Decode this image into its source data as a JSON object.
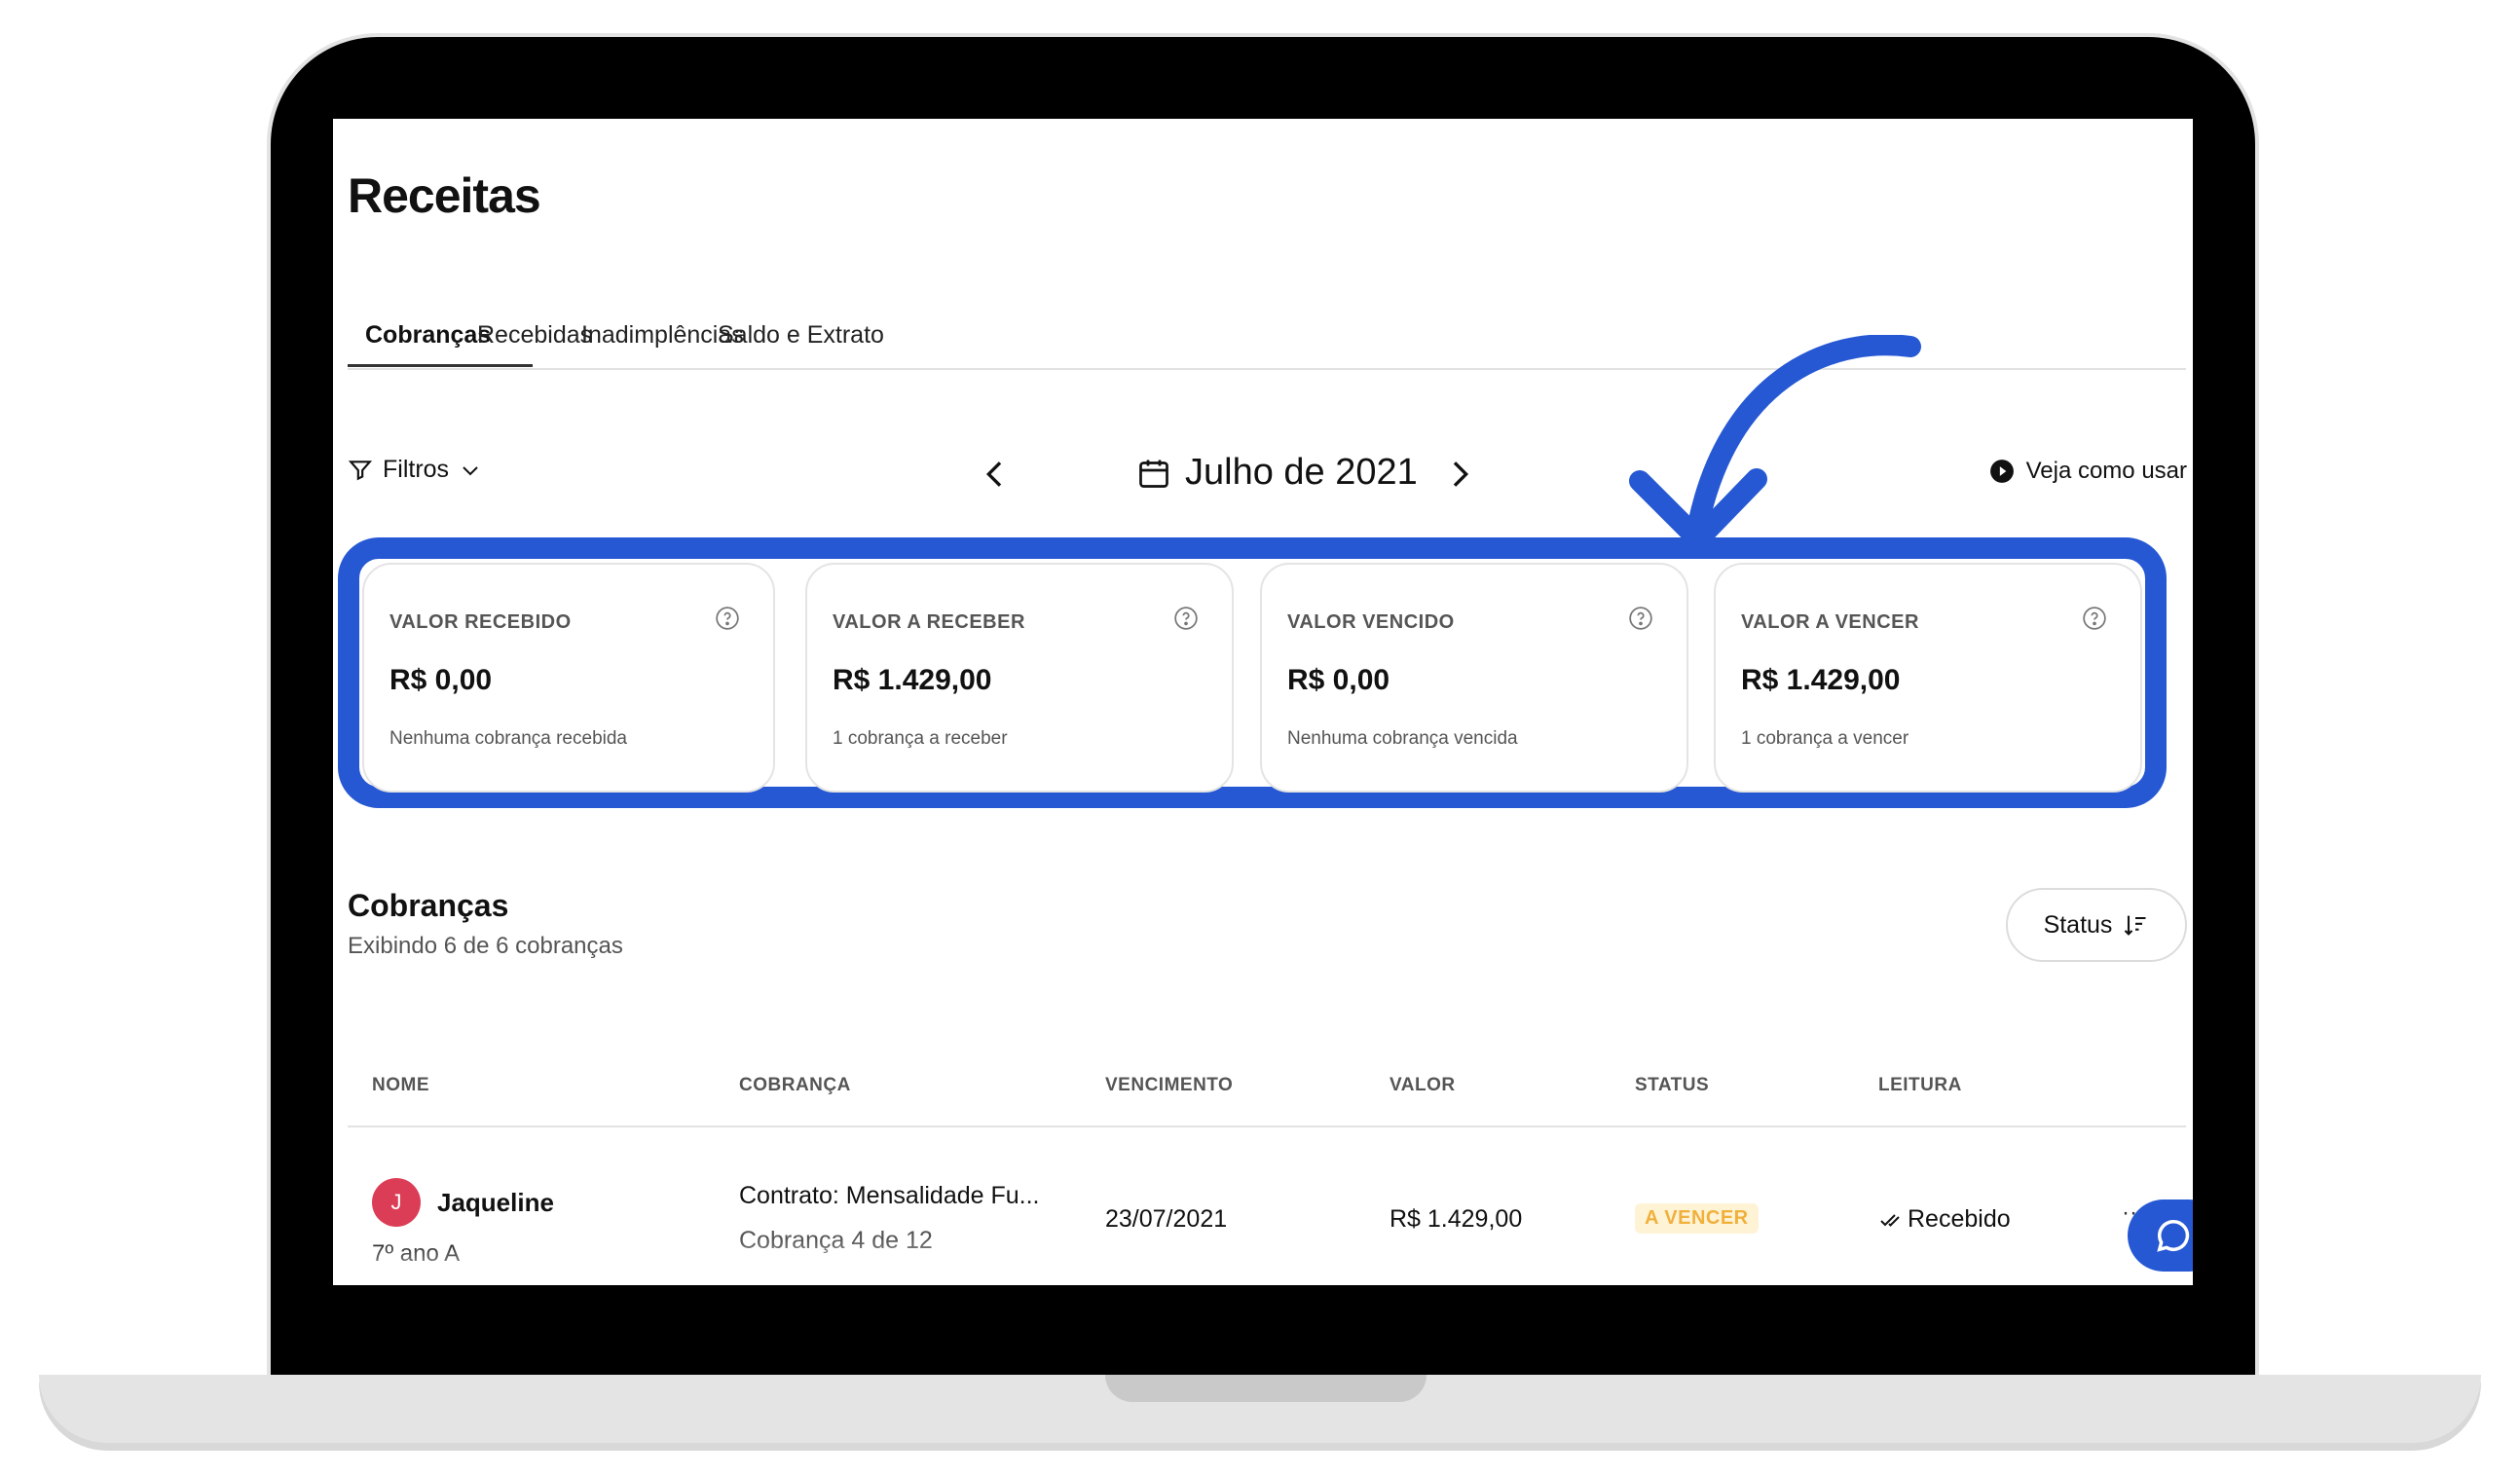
{
  "page": {
    "title": "Receitas"
  },
  "tabs": [
    {
      "label": "Cobranças"
    },
    {
      "label": "Recebidas"
    },
    {
      "label": "Inadimplências"
    },
    {
      "label": "Saldo e Extrato"
    }
  ],
  "toolbar": {
    "filters_label": "Filtros",
    "month_label": "Julho de 2021",
    "how_to_label": "Veja como usar"
  },
  "cards": [
    {
      "title": "VALOR RECEBIDO",
      "value": "R$ 0,00",
      "subtitle": "Nenhuma cobrança recebida"
    },
    {
      "title": "VALOR A RECEBER",
      "value": "R$ 1.429,00",
      "subtitle": "1 cobrança a receber"
    },
    {
      "title": "VALOR VENCIDO",
      "value": "R$ 0,00",
      "subtitle": "Nenhuma cobrança vencida"
    },
    {
      "title": "VALOR A VENCER",
      "value": "R$ 1.429,00",
      "subtitle": "1 cobrança a vencer"
    }
  ],
  "section": {
    "title": "Cobranças",
    "subtitle": "Exibindo 6 de 6 cobranças",
    "sort_label": "Status"
  },
  "table": {
    "columns": [
      "NOME",
      "COBRANÇA",
      "VENCIMENTO",
      "VALOR",
      "STATUS",
      "LEITURA"
    ],
    "rows": [
      {
        "avatar_initial": "J",
        "name": "Jaqueline",
        "class": "7º ano A",
        "contract": "Contrato: Mensalidade Fu...",
        "installment": "Cobrança 4 de 12",
        "due_date": "23/07/2021",
        "amount": "R$ 1.429,00",
        "status": "A VENCER",
        "reading": "Recebido",
        "more": "···"
      }
    ]
  },
  "colors": {
    "highlight": "#2658d4",
    "avatar": "#dc3d56",
    "status_text": "#f0b03c",
    "status_bg": "#fff3d6"
  },
  "icons": [
    "filter-icon",
    "chevron-down-icon",
    "chevron-left-icon",
    "calendar-icon",
    "chevron-right-icon",
    "play-icon",
    "help-icon",
    "sort-icon",
    "check-icon",
    "chat-icon",
    "curved-arrow-icon"
  ]
}
